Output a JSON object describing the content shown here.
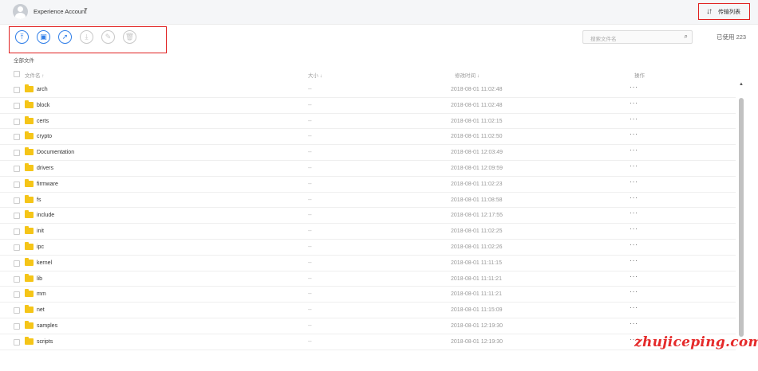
{
  "header": {
    "account_name": "Experience Account",
    "account_caret": "▼",
    "transfer_icon": "↓↑",
    "transfer_label": "传输列表"
  },
  "toolbar": {
    "buttons": [
      {
        "name": "upload",
        "icon": "upload-icon",
        "glyph": "⤒",
        "enabled": true
      },
      {
        "name": "new-folder",
        "icon": "folder-plus-icon",
        "glyph": "▣",
        "enabled": true
      },
      {
        "name": "share",
        "icon": "send-icon",
        "glyph": "➚",
        "enabled": true
      },
      {
        "name": "download",
        "icon": "download-icon",
        "glyph": "⤓",
        "enabled": false
      },
      {
        "name": "rename",
        "icon": "pencil-icon",
        "glyph": "✎",
        "enabled": false
      },
      {
        "name": "delete",
        "icon": "trash-icon",
        "glyph": "🗑",
        "enabled": false
      }
    ]
  },
  "search": {
    "placeholder": "搜索文件名",
    "icon_glyph": "⌕"
  },
  "quota": {
    "text": "已使用 223"
  },
  "breadcrumb": {
    "label": "全部文件"
  },
  "table": {
    "columns": {
      "name": "文件名 ↑",
      "size": "大小 ↓",
      "modified": "修改时间 ↓",
      "actions": "操作"
    },
    "rows": [
      {
        "name": "arch",
        "size": "--",
        "modified": "2018-08-01 11:02:48",
        "ops": "···"
      },
      {
        "name": "block",
        "size": "--",
        "modified": "2018-08-01 11:02:48",
        "ops": "···"
      },
      {
        "name": "certs",
        "size": "--",
        "modified": "2018-08-01 11:02:15",
        "ops": "···"
      },
      {
        "name": "crypto",
        "size": "--",
        "modified": "2018-08-01 11:02:50",
        "ops": "···"
      },
      {
        "name": "Documentation",
        "size": "--",
        "modified": "2018-08-01 12:03:49",
        "ops": "···"
      },
      {
        "name": "drivers",
        "size": "--",
        "modified": "2018-08-01 12:09:59",
        "ops": "···"
      },
      {
        "name": "firmware",
        "size": "--",
        "modified": "2018-08-01 11:02:23",
        "ops": "···"
      },
      {
        "name": "fs",
        "size": "--",
        "modified": "2018-08-01 11:08:58",
        "ops": "···"
      },
      {
        "name": "include",
        "size": "--",
        "modified": "2018-08-01 12:17:55",
        "ops": "···"
      },
      {
        "name": "init",
        "size": "--",
        "modified": "2018-08-01 11:02:25",
        "ops": "···"
      },
      {
        "name": "ipc",
        "size": "--",
        "modified": "2018-08-01 11:02:26",
        "ops": "···"
      },
      {
        "name": "kernel",
        "size": "--",
        "modified": "2018-08-01 11:11:15",
        "ops": "···"
      },
      {
        "name": "lib",
        "size": "--",
        "modified": "2018-08-01 11:11:21",
        "ops": "···"
      },
      {
        "name": "mm",
        "size": "--",
        "modified": "2018-08-01 11:11:21",
        "ops": "···"
      },
      {
        "name": "net",
        "size": "--",
        "modified": "2018-08-01 11:15:09",
        "ops": "···"
      },
      {
        "name": "samples",
        "size": "--",
        "modified": "2018-08-01 12:19:30",
        "ops": "···"
      },
      {
        "name": "scripts",
        "size": "--",
        "modified": "2018-08-01 12:19:30",
        "ops": "···"
      }
    ]
  },
  "watermark": {
    "text": "zhujiceping.com"
  },
  "colors": {
    "accent": "#2f7ee8",
    "highlight_box": "#e02020",
    "folder": "#f5c518",
    "watermark": "#e52a2a"
  }
}
